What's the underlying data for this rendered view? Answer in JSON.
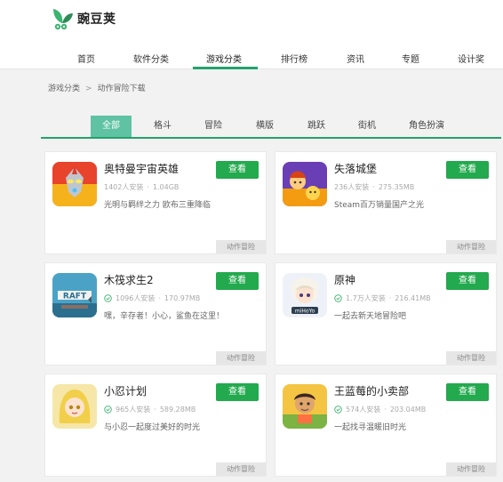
{
  "brand": {
    "name": "豌豆荚",
    "accent": "#23a26b",
    "button_color": "#23a94e",
    "active_tab_color": "#5fc3a3"
  },
  "nav": {
    "items": [
      "首页",
      "软件分类",
      "游戏分类",
      "排行榜",
      "资讯",
      "专题",
      "设计奖"
    ],
    "active": "游戏分类"
  },
  "breadcrumb": {
    "parent": "游戏分类",
    "separator": ">",
    "current": "动作冒险下载"
  },
  "tabs": {
    "items": [
      "全部",
      "格斗",
      "冒险",
      "横版",
      "跳跃",
      "街机",
      "角色扮演"
    ],
    "active": "全部"
  },
  "apps": [
    {
      "name": "奥特曼宇宙英雄",
      "installs": "1402人安装",
      "size": "1.04GB",
      "desc": "光明与羁绊之力 欧布三重降临",
      "tag": "动作冒险",
      "button": "查看",
      "verified": false,
      "icon": "ultraman-icon"
    },
    {
      "name": "失落城堡",
      "installs": "236人安装",
      "size": "275.35MB",
      "desc": "Steam百万销量国产之光",
      "tag": "动作冒险",
      "button": "查看",
      "verified": false,
      "icon": "lost-castle-icon"
    },
    {
      "name": "木筏求生2",
      "installs": "1096人安装",
      "size": "170.97MB",
      "desc": "嘿，辛存者！小心，鲨鱼在这里！",
      "tag": "动作冒险",
      "button": "查看",
      "verified": true,
      "icon": "raft-icon"
    },
    {
      "name": "原神",
      "installs": "1.7万人安装",
      "size": "216.41MB",
      "desc": "一起去新天地冒险吧",
      "tag": "动作冒险",
      "button": "查看",
      "verified": true,
      "icon": "genshin-icon"
    },
    {
      "name": "小忍计划",
      "installs": "965人安装",
      "size": "589.28MB",
      "desc": "与小忍一起度过美好的时光",
      "tag": "动作冒险",
      "button": "查看",
      "verified": true,
      "icon": "shinobu-icon"
    },
    {
      "name": "王蓝莓的小卖部",
      "installs": "574人安装",
      "size": "203.04MB",
      "desc": "一起找寻温暖旧时光",
      "tag": "动作冒险",
      "button": "查看",
      "verified": true,
      "icon": "shop-icon"
    }
  ]
}
